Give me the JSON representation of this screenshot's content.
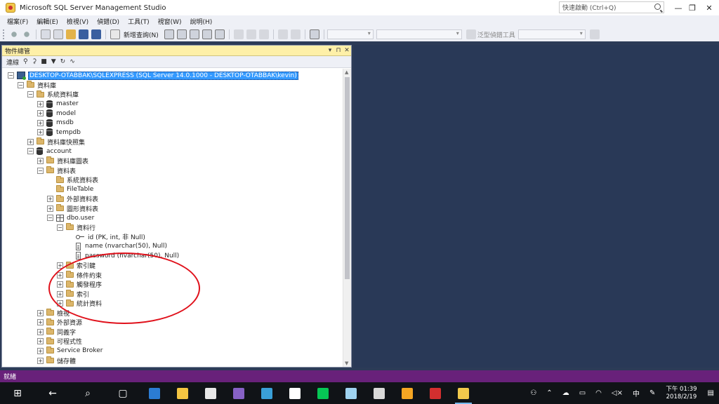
{
  "window": {
    "title": "Microsoft SQL Server Management Studio",
    "quick_launch_placeholder": "快速啟動 (Ctrl+Q)",
    "controls": [
      "—",
      "❐",
      "✕"
    ]
  },
  "menu": [
    "檔案(F)",
    "編輯(E)",
    "檢視(V)",
    "偵錯(D)",
    "工具(T)",
    "視窗(W)",
    "說明(H)"
  ],
  "toolbar": {
    "new_query_label": "新增查詢(N)",
    "generic_debugger_label": "泛型偵錯工具"
  },
  "object_explorer": {
    "title": "物件總管",
    "header_buttons": [
      "▾",
      "⊓",
      "✕"
    ],
    "connect_label": "連線",
    "tree": [
      {
        "level": 0,
        "exp": "−",
        "icon": "server",
        "text": "DESKTOP-OTABBAK\\SQLEXPRESS (SQL Server 14.0.1000 - DESKTOP-OTABBAK\\kevin)",
        "selected": true
      },
      {
        "level": 1,
        "exp": "−",
        "icon": "folder",
        "text": "資料庫"
      },
      {
        "level": 2,
        "exp": "−",
        "icon": "folder",
        "text": "系統資料庫"
      },
      {
        "level": 3,
        "exp": "+",
        "icon": "db",
        "text": "master"
      },
      {
        "level": 3,
        "exp": "+",
        "icon": "db",
        "text": "model"
      },
      {
        "level": 3,
        "exp": "+",
        "icon": "db",
        "text": "msdb"
      },
      {
        "level": 3,
        "exp": "+",
        "icon": "db",
        "text": "tempdb"
      },
      {
        "level": 2,
        "exp": "+",
        "icon": "folder",
        "text": "資料庫快照集"
      },
      {
        "level": 2,
        "exp": "−",
        "icon": "db",
        "text": "account"
      },
      {
        "level": 3,
        "exp": "+",
        "icon": "folder",
        "text": "資料庫圖表"
      },
      {
        "level": 3,
        "exp": "−",
        "icon": "folder",
        "text": "資料表"
      },
      {
        "level": 4,
        "exp": "",
        "icon": "folder",
        "text": "系統資料表"
      },
      {
        "level": 4,
        "exp": "",
        "icon": "folder",
        "text": "FileTable"
      },
      {
        "level": 4,
        "exp": "+",
        "icon": "folder",
        "text": "外部資料表"
      },
      {
        "level": 4,
        "exp": "+",
        "icon": "folder",
        "text": "圖形資料表"
      },
      {
        "level": 4,
        "exp": "−",
        "icon": "table",
        "text": "dbo.user"
      },
      {
        "level": 5,
        "exp": "−",
        "icon": "folder",
        "text": "資料行"
      },
      {
        "level": 6,
        "exp": "",
        "icon": "key",
        "text": "id (PK, int, 非 Null)"
      },
      {
        "level": 6,
        "exp": "",
        "icon": "column",
        "text": "name (nvarchar(50), Null)"
      },
      {
        "level": 6,
        "exp": "",
        "icon": "column",
        "text": "password (nvarchar(50), Null)"
      },
      {
        "level": 5,
        "exp": "+",
        "icon": "folder",
        "text": "索引鍵"
      },
      {
        "level": 5,
        "exp": "+",
        "icon": "folder",
        "text": "條件約束"
      },
      {
        "level": 5,
        "exp": "+",
        "icon": "folder",
        "text": "觸發程序"
      },
      {
        "level": 5,
        "exp": "+",
        "icon": "folder",
        "text": "索引"
      },
      {
        "level": 5,
        "exp": "+",
        "icon": "folder",
        "text": "統計資料"
      },
      {
        "level": 3,
        "exp": "+",
        "icon": "folder",
        "text": "檢視"
      },
      {
        "level": 3,
        "exp": "+",
        "icon": "folder",
        "text": "外部資源"
      },
      {
        "level": 3,
        "exp": "+",
        "icon": "folder",
        "text": "同義字"
      },
      {
        "level": 3,
        "exp": "+",
        "icon": "folder",
        "text": "可程式性"
      },
      {
        "level": 3,
        "exp": "+",
        "icon": "folder",
        "text": "Service Broker"
      },
      {
        "level": 3,
        "exp": "+",
        "icon": "folder",
        "text": "儲存體"
      }
    ]
  },
  "status": {
    "text": "就緒"
  },
  "taskbar": {
    "apps": [
      {
        "name": "windows-start-icon",
        "color": "#ffffff"
      },
      {
        "name": "back-arrow-icon",
        "color": "#ffffff"
      },
      {
        "name": "search-icon",
        "color": "#ffffff"
      },
      {
        "name": "task-view-icon",
        "color": "#ffffff"
      },
      {
        "name": "edge-icon",
        "color": "#2b7cd3"
      },
      {
        "name": "file-explorer-icon",
        "color": "#f4c542"
      },
      {
        "name": "store-icon",
        "color": "#e8e8e8"
      },
      {
        "name": "visual-studio-icon",
        "color": "#8661c5"
      },
      {
        "name": "media-player-icon",
        "color": "#3aa0d8"
      },
      {
        "name": "chrome-icon",
        "color": "#ffffff"
      },
      {
        "name": "line-icon",
        "color": "#06c755"
      },
      {
        "name": "notes-icon",
        "color": "#9fd3f0"
      },
      {
        "name": "mail-icon",
        "color": "#d9d9d9"
      },
      {
        "name": "paint-icon",
        "color": "#f5a623"
      },
      {
        "name": "news-icon",
        "color": "#d32f2f"
      },
      {
        "name": "ssms-icon",
        "color": "#f2c94c"
      }
    ],
    "tray_icons": [
      "person-icon",
      "chevron-up-icon",
      "cloud-icon",
      "display-icon",
      "wifi-icon",
      "volume-icon",
      "pen-icon"
    ],
    "ime": "中",
    "time": "下午 01:39",
    "date": "2018/2/19"
  }
}
